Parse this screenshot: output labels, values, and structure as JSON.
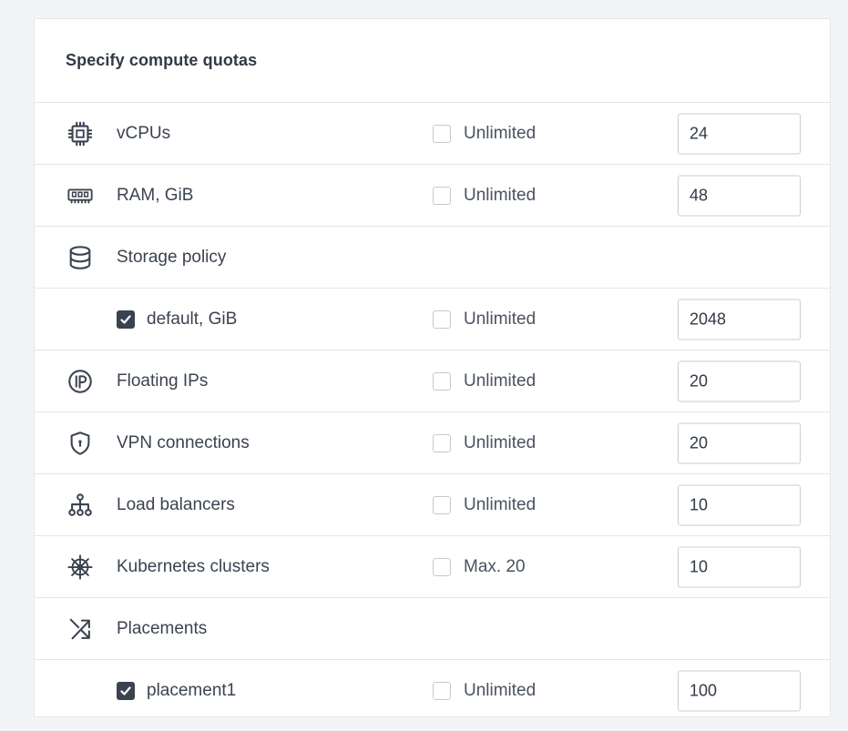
{
  "panel": {
    "title": "Specify compute quotas"
  },
  "rows": [
    {
      "icon": "cpu-icon",
      "label": "vCPUs",
      "unlimited_label": "Unlimited",
      "unlimited_checked": false,
      "value": "24"
    },
    {
      "icon": "ram-icon",
      "label": "RAM, GiB",
      "unlimited_label": "Unlimited",
      "unlimited_checked": false,
      "value": "48"
    },
    {
      "icon": "database-icon",
      "label": "Storage policy"
    },
    {
      "sub_label": "default, GiB",
      "sub_checked": true,
      "unlimited_label": "Unlimited",
      "unlimited_checked": false,
      "value": "2048"
    },
    {
      "icon": "floating-ip-icon",
      "label": "Floating IPs",
      "unlimited_label": "Unlimited",
      "unlimited_checked": false,
      "value": "20"
    },
    {
      "icon": "shield-lock-icon",
      "label": "VPN connections",
      "unlimited_label": "Unlimited",
      "unlimited_checked": false,
      "value": "20"
    },
    {
      "icon": "load-balancer-icon",
      "label": "Load balancers",
      "unlimited_label": "Unlimited",
      "unlimited_checked": false,
      "value": "10"
    },
    {
      "icon": "kubernetes-icon",
      "label": "Kubernetes clusters",
      "unlimited_label": "Max. 20",
      "unlimited_checked": false,
      "value": "10"
    },
    {
      "icon": "shuffle-icon",
      "label": "Placements"
    },
    {
      "sub_label": "placement1",
      "sub_checked": true,
      "unlimited_label": "Unlimited",
      "unlimited_checked": false,
      "value": "100"
    }
  ],
  "colors": {
    "text": "#3b4350",
    "border": "#e3e6ea",
    "checkbox_checked": "#3b4350"
  }
}
